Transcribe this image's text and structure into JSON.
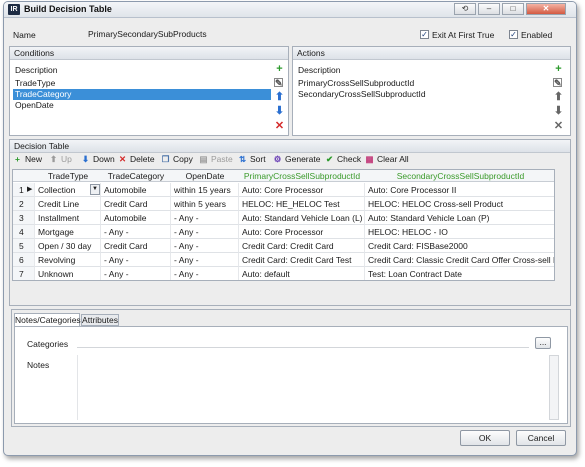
{
  "window": {
    "title": "Build Decision Table",
    "app_icon": "IR"
  },
  "titlebar_buttons": [
    "⟲",
    "–",
    "□",
    "✕"
  ],
  "name": {
    "label": "Name",
    "value": "PrimarySecondarySubProducts"
  },
  "options": {
    "exit_first_true": {
      "label": "Exit At First True",
      "checked": true
    },
    "enabled": {
      "label": "Enabled",
      "checked": true
    }
  },
  "conditions": {
    "title": "Conditions",
    "column": "Description",
    "items": [
      "TradeType",
      "TradeCategory",
      "OpenDate"
    ],
    "selected_index": 1
  },
  "actions": {
    "title": "Actions",
    "column": "Description",
    "items": [
      "PrimaryCrossSellSubproductId",
      "SecondaryCrossSellSubproductId"
    ]
  },
  "decision_table": {
    "title": "Decision Table",
    "toolbar": {
      "new": "New",
      "up": "Up",
      "down": "Down",
      "delete": "Delete",
      "copy": "Copy",
      "paste": "Paste",
      "sort": "Sort",
      "generate": "Generate",
      "check": "Check",
      "clear_all": "Clear All"
    },
    "columns": [
      "TradeType",
      "TradeCategory",
      "OpenDate",
      "PrimaryCrossSellSubproductId",
      "SecondaryCrossSellSubproductId"
    ],
    "rows": [
      {
        "n": "1",
        "trade_type": "Collection",
        "category": "Automobile",
        "open_date": "within 15 years",
        "primary": "Auto: Core Processor",
        "secondary": "Auto: Core Processor II"
      },
      {
        "n": "2",
        "trade_type": "Credit Line",
        "category": "Credit Card",
        "open_date": "within 5 years",
        "primary": "HELOC: HE_HELOC Test",
        "secondary": "HELOC: HELOC Cross-sell Product"
      },
      {
        "n": "3",
        "trade_type": "Installment",
        "category": "Automobile",
        "open_date": "- Any -",
        "primary": "Auto: Standard Vehicle Loan (L)",
        "secondary": "Auto: Standard Vehicle Loan (P)"
      },
      {
        "n": "4",
        "trade_type": "Mortgage",
        "category": "- Any -",
        "open_date": "- Any -",
        "primary": "Auto: Core Processor",
        "secondary": "HELOC: HELOC - IO"
      },
      {
        "n": "5",
        "trade_type": "Open / 30 day",
        "category": "Credit Card",
        "open_date": "- Any -",
        "primary": "Credit Card: Credit Card",
        "secondary": "Credit Card: FISBase2000"
      },
      {
        "n": "6",
        "trade_type": "Revolving",
        "category": "- Any -",
        "open_date": "- Any -",
        "primary": "Credit Card: Credit Card Test",
        "secondary": "Credit Card: Classic Credit Card Offer Cross-sell Product"
      },
      {
        "n": "7",
        "trade_type": "Unknown",
        "category": "- Any -",
        "open_date": "- Any -",
        "primary": "Auto: default",
        "secondary": "Test: Loan Contract Date"
      }
    ]
  },
  "tabs": {
    "notes_categories": "Notes/Categories",
    "attributes": "Attributes"
  },
  "notes_tab": {
    "categories_label": "Categories",
    "notes_label": "Notes",
    "browse_label": "..."
  },
  "buttons": {
    "ok": "OK",
    "cancel": "Cancel"
  },
  "colors": {
    "accent": "#3b8fd8",
    "green_header": "#3a9a2a",
    "delete_red": "#d42a2a",
    "arrow_blue": "#2a6fd0"
  }
}
